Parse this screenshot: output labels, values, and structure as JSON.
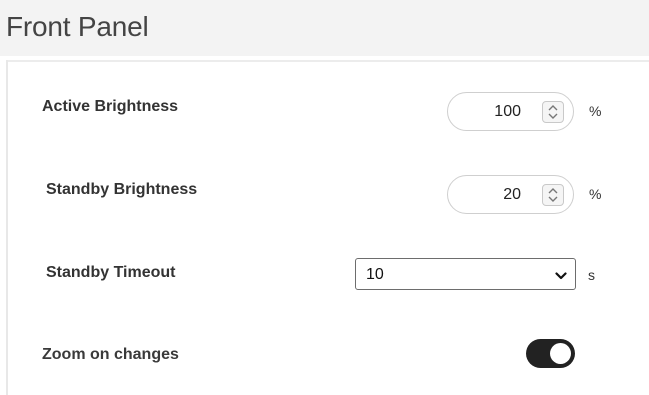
{
  "header": {
    "title": "Front Panel"
  },
  "settings": {
    "active_brightness": {
      "label": "Active Brightness",
      "value": "100",
      "unit": "%"
    },
    "standby_brightness": {
      "label": "Standby Brightness",
      "value": "20",
      "unit": "%"
    },
    "standby_timeout": {
      "label": "Standby Timeout",
      "value": "10",
      "unit": "s"
    },
    "zoom_on_changes": {
      "label": "Zoom on changes",
      "enabled": true
    }
  },
  "icons": {
    "spinner": "up-down-arrows-icon",
    "select": "chevron-down-icon"
  },
  "colors": {
    "header_bg": "#f3f3f3",
    "toggle_on": "#222222"
  }
}
